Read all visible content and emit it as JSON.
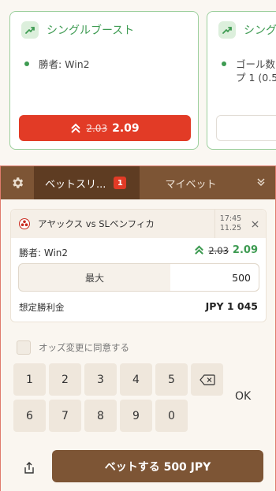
{
  "boosts": [
    {
      "title": "シングルブースト",
      "selection": "勝者: Win2",
      "old_odds": "2.03",
      "new_odds": "2.09"
    },
    {
      "title": "シングル",
      "selection": "ゴール数",
      "selection2": "プ 1 (0.5"
    }
  ],
  "tabs": {
    "betslip_label": "ベットスリ...",
    "betslip_count": "1",
    "mybets_label": "マイベット"
  },
  "bet": {
    "match": "アヤックス vs SLベンフィカ",
    "time": "17:45",
    "date": "11.25",
    "selection": "勝者: Win2",
    "old_odds": "2.03",
    "new_odds": "2.09",
    "max_label": "最大",
    "stake_value": "500",
    "payout_label": "想定勝利金",
    "payout_value": "JPY 1 045"
  },
  "agree_label": "オッズ変更に同意する",
  "keypad": {
    "keys": [
      "1",
      "2",
      "3",
      "4",
      "5",
      "6",
      "7",
      "8",
      "9",
      "0"
    ],
    "ok_label": "OK"
  },
  "place_bet_label": "ベットする 500 JPY",
  "colors": {
    "brand_brown": "#7d5535",
    "boost_red": "#e23b26",
    "boost_green": "#3e9b52"
  }
}
